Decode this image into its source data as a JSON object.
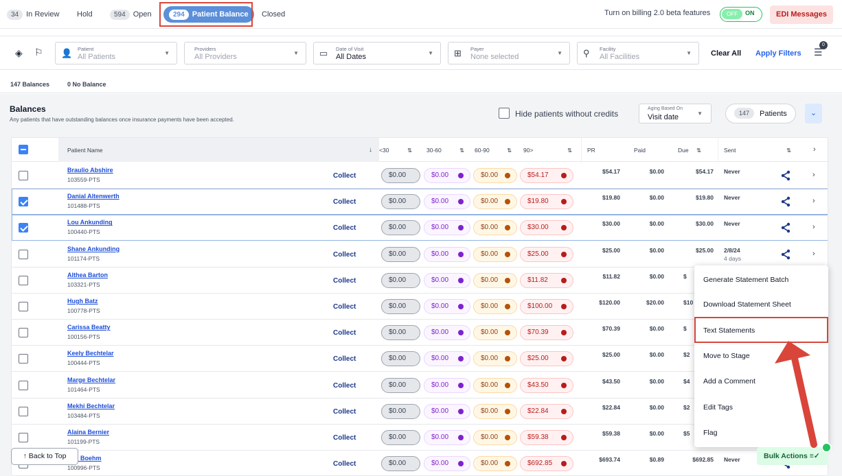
{
  "tabs": [
    {
      "count": "34",
      "label": "In Review"
    },
    {
      "count": "",
      "label": "Hold"
    },
    {
      "count": "594",
      "label": "Open"
    },
    {
      "count": "294",
      "label": "Patient Balance"
    },
    {
      "count": "",
      "label": "Closed"
    }
  ],
  "beta": {
    "label": "Turn on billing 2.0 beta features",
    "off": "OFF",
    "on": "ON"
  },
  "edi_button": "EDI Messages",
  "filters": {
    "patient": {
      "label": "Patient",
      "value": "All Patients"
    },
    "providers": {
      "label": "Providers",
      "value": "All Providers"
    },
    "date": {
      "label": "Date of Visit",
      "value": "All Dates"
    },
    "payer": {
      "label": "Payer",
      "value": "None selected"
    },
    "facility": {
      "label": "Facility",
      "value": "All Facilities"
    },
    "clear": "Clear All",
    "apply": "Apply Filters",
    "badge": "0"
  },
  "summary": {
    "balances": "147 Balances",
    "no_balance": "0 No Balance"
  },
  "balances": {
    "title": "Balances",
    "desc": "Any patients that have outstanding balances once insurance payments have been accepted.",
    "hide_label": "Hide patients without credits",
    "aging_label": "Aging Based On",
    "aging_value": "Visit date",
    "patients_count": "147",
    "patients_label": "Patients"
  },
  "columns": {
    "patient_name": "Patient Name",
    "b30": "<30",
    "b60": "30-60",
    "b90": "60-90",
    "b90p": "90>",
    "pr": "PR",
    "paid": "Paid",
    "due": "Due",
    "sent": "Sent"
  },
  "rows": [
    {
      "name": "Braulio Abshire",
      "id": "103559-PTS",
      "collect": "Collect",
      "a": "$0.00",
      "b": "$0.00",
      "c": "$0.00",
      "d": "$54.17",
      "pr": "$54.17",
      "paid": "$0.00",
      "due": "$54.17",
      "sent": "Never",
      "sent2": "",
      "checked": false
    },
    {
      "name": "Danial Altenwerth",
      "id": "101488-PTS",
      "collect": "Collect",
      "a": "$0.00",
      "b": "$0.00",
      "c": "$0.00",
      "d": "$19.80",
      "pr": "$19.80",
      "paid": "$0.00",
      "due": "$19.80",
      "sent": "Never",
      "sent2": "",
      "checked": true
    },
    {
      "name": "Lou Ankunding",
      "id": "100440-PTS",
      "collect": "Collect",
      "a": "$0.00",
      "b": "$0.00",
      "c": "$0.00",
      "d": "$30.00",
      "pr": "$30.00",
      "paid": "$0.00",
      "due": "$30.00",
      "sent": "Never",
      "sent2": "",
      "checked": true
    },
    {
      "name": "Shane Ankunding",
      "id": "101174-PTS",
      "collect": "Collect",
      "a": "$0.00",
      "b": "$0.00",
      "c": "$0.00",
      "d": "$25.00",
      "pr": "$25.00",
      "paid": "$0.00",
      "due": "$25.00",
      "sent": "2/8/24",
      "sent2": "4 days",
      "checked": false
    },
    {
      "name": "Althea Barton",
      "id": "103321-PTS",
      "collect": "Collect",
      "a": "$0.00",
      "b": "$0.00",
      "c": "$0.00",
      "d": "$11.82",
      "pr": "$11.82",
      "paid": "$0.00",
      "due": "$",
      "sent": "",
      "sent2": "",
      "checked": false
    },
    {
      "name": "Hugh Batz",
      "id": "100778-PTS",
      "collect": "Collect",
      "a": "$0.00",
      "b": "$0.00",
      "c": "$0.00",
      "d": "$100.00",
      "pr": "$120.00",
      "paid": "$20.00",
      "due": "$10",
      "sent": "",
      "sent2": "",
      "checked": false
    },
    {
      "name": "Carissa Beatty",
      "id": "100156-PTS",
      "collect": "Collect",
      "a": "$0.00",
      "b": "$0.00",
      "c": "$0.00",
      "d": "$70.39",
      "pr": "$70.39",
      "paid": "$0.00",
      "due": "$",
      "sent": "",
      "sent2": "",
      "checked": false
    },
    {
      "name": "Keely Bechtelar",
      "id": "100444-PTS",
      "collect": "Collect",
      "a": "$0.00",
      "b": "$0.00",
      "c": "$0.00",
      "d": "$25.00",
      "pr": "$25.00",
      "paid": "$0.00",
      "due": "$2",
      "sent": "",
      "sent2": "",
      "checked": false
    },
    {
      "name": "Marge Bechtelar",
      "id": "101464-PTS",
      "collect": "Collect",
      "a": "$0.00",
      "b": "$0.00",
      "c": "$0.00",
      "d": "$43.50",
      "pr": "$43.50",
      "paid": "$0.00",
      "due": "$4",
      "sent": "",
      "sent2": "",
      "checked": false
    },
    {
      "name": "Mekhi Bechtelar",
      "id": "103484-PTS",
      "collect": "Collect",
      "a": "$0.00",
      "b": "$0.00",
      "c": "$0.00",
      "d": "$22.84",
      "pr": "$22.84",
      "paid": "$0.00",
      "due": "$2",
      "sent": "",
      "sent2": "",
      "checked": false
    },
    {
      "name": "Alaina Bernier",
      "id": "101199-PTS",
      "collect": "Collect",
      "a": "$0.00",
      "b": "$0.00",
      "c": "$0.00",
      "d": "$59.38",
      "pr": "$59.38",
      "paid": "$0.00",
      "due": "$5",
      "sent": "",
      "sent2": "",
      "checked": false
    },
    {
      "name": "don Boehm",
      "id": "100996-PTS",
      "collect": "Collect",
      "a": "$0.00",
      "b": "$0.00",
      "c": "$0.00",
      "d": "$692.85",
      "pr": "$693.74",
      "paid": "$0.89",
      "due": "$692.85",
      "sent": "Never",
      "sent2": "",
      "checked": false
    }
  ],
  "menu": [
    "Generate Statement Batch",
    "Download Statement Sheet",
    "Text Statements",
    "Move to Stage",
    "Add a Comment",
    "Edit Tags",
    "Flag"
  ],
  "back_to_top": "↑  Back to Top",
  "bulk_actions": "Bulk Actions  ≡✓",
  "accent": {
    "highlight": "#d9453a",
    "primary": "#5b8fd9",
    "link": "#1d4ed8"
  }
}
